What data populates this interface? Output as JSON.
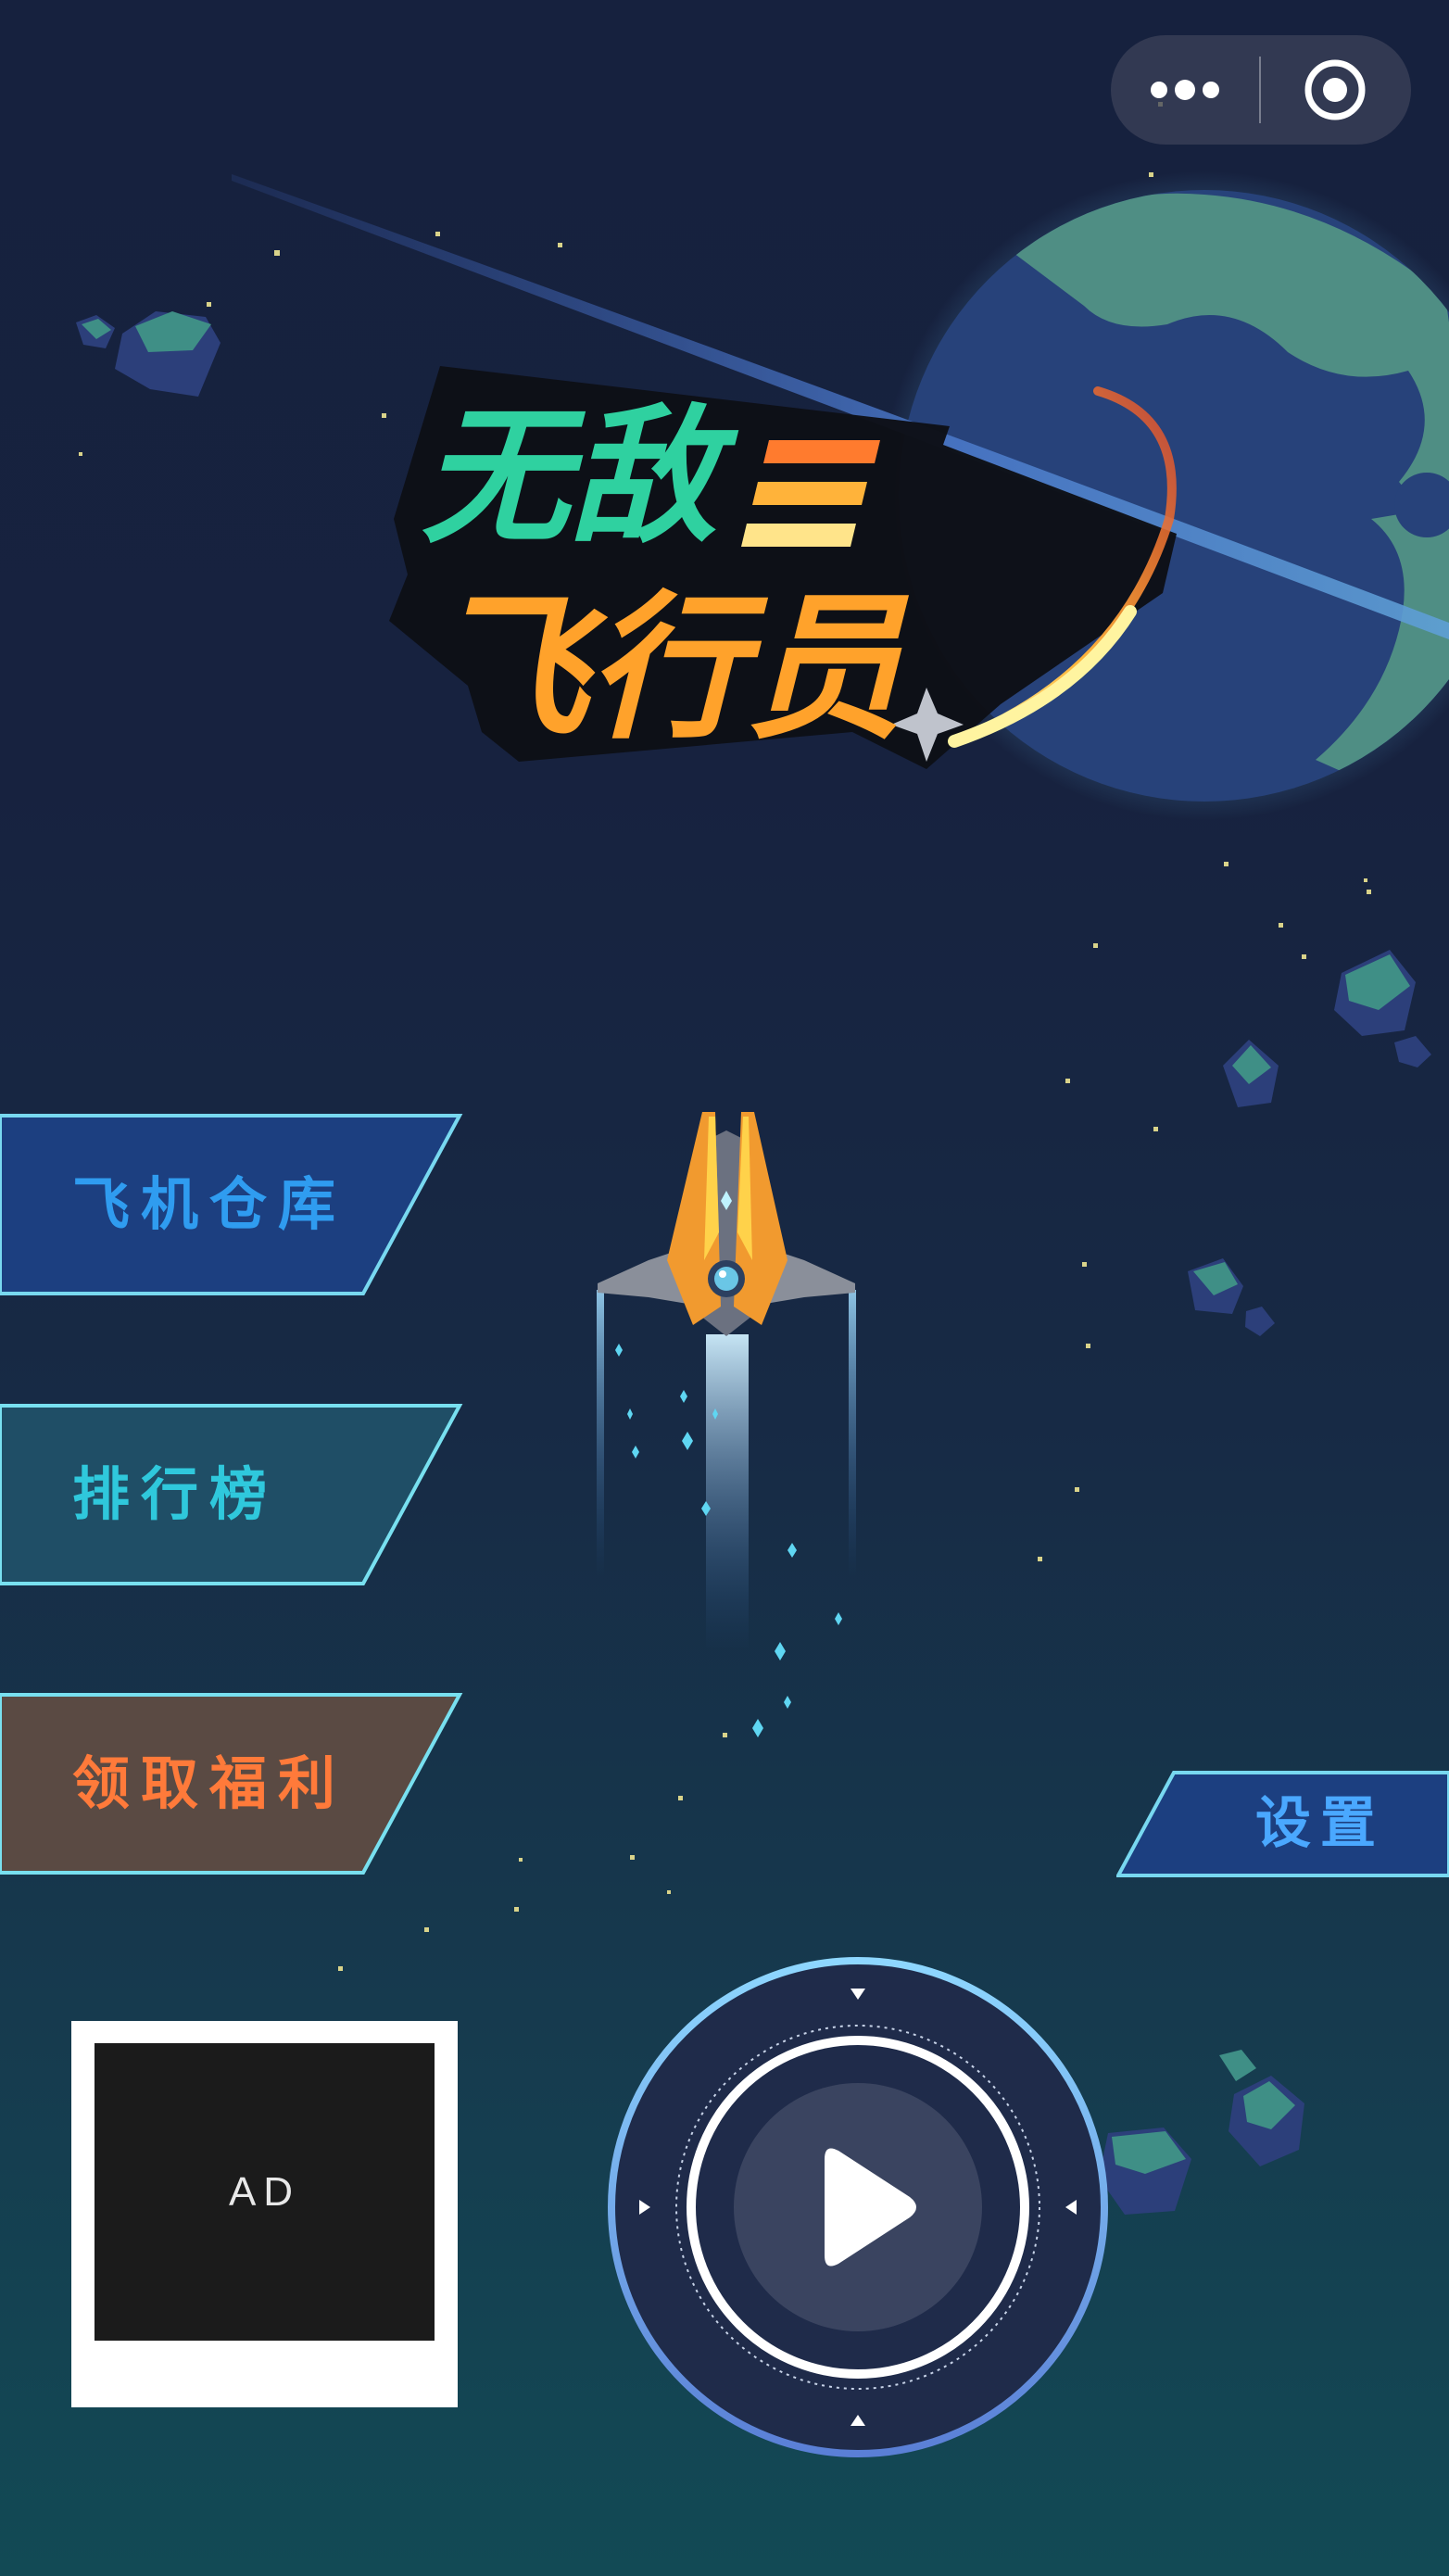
{
  "capsule": {
    "more_icon": "more-dots-icon",
    "close_icon": "target-circle-icon"
  },
  "title": {
    "line1": "无敌",
    "line2": "飞行员",
    "numeral": "三"
  },
  "menu": {
    "hangar": {
      "label": "飞机仓库",
      "color": "#2f9cf0"
    },
    "leaderboard": {
      "label": "排行榜",
      "color": "#2fc8dc"
    },
    "bonus": {
      "label": "领取福利",
      "color": "#ff7a3a"
    }
  },
  "settings": {
    "label": "设置"
  },
  "ad": {
    "label": "AD"
  },
  "play": {
    "icon": "play-icon"
  },
  "colors": {
    "accent_cyan": "#7ee6f5",
    "title_green": "#2fd1a0",
    "title_orange": "#ffa22b",
    "planet": "#27427a"
  }
}
